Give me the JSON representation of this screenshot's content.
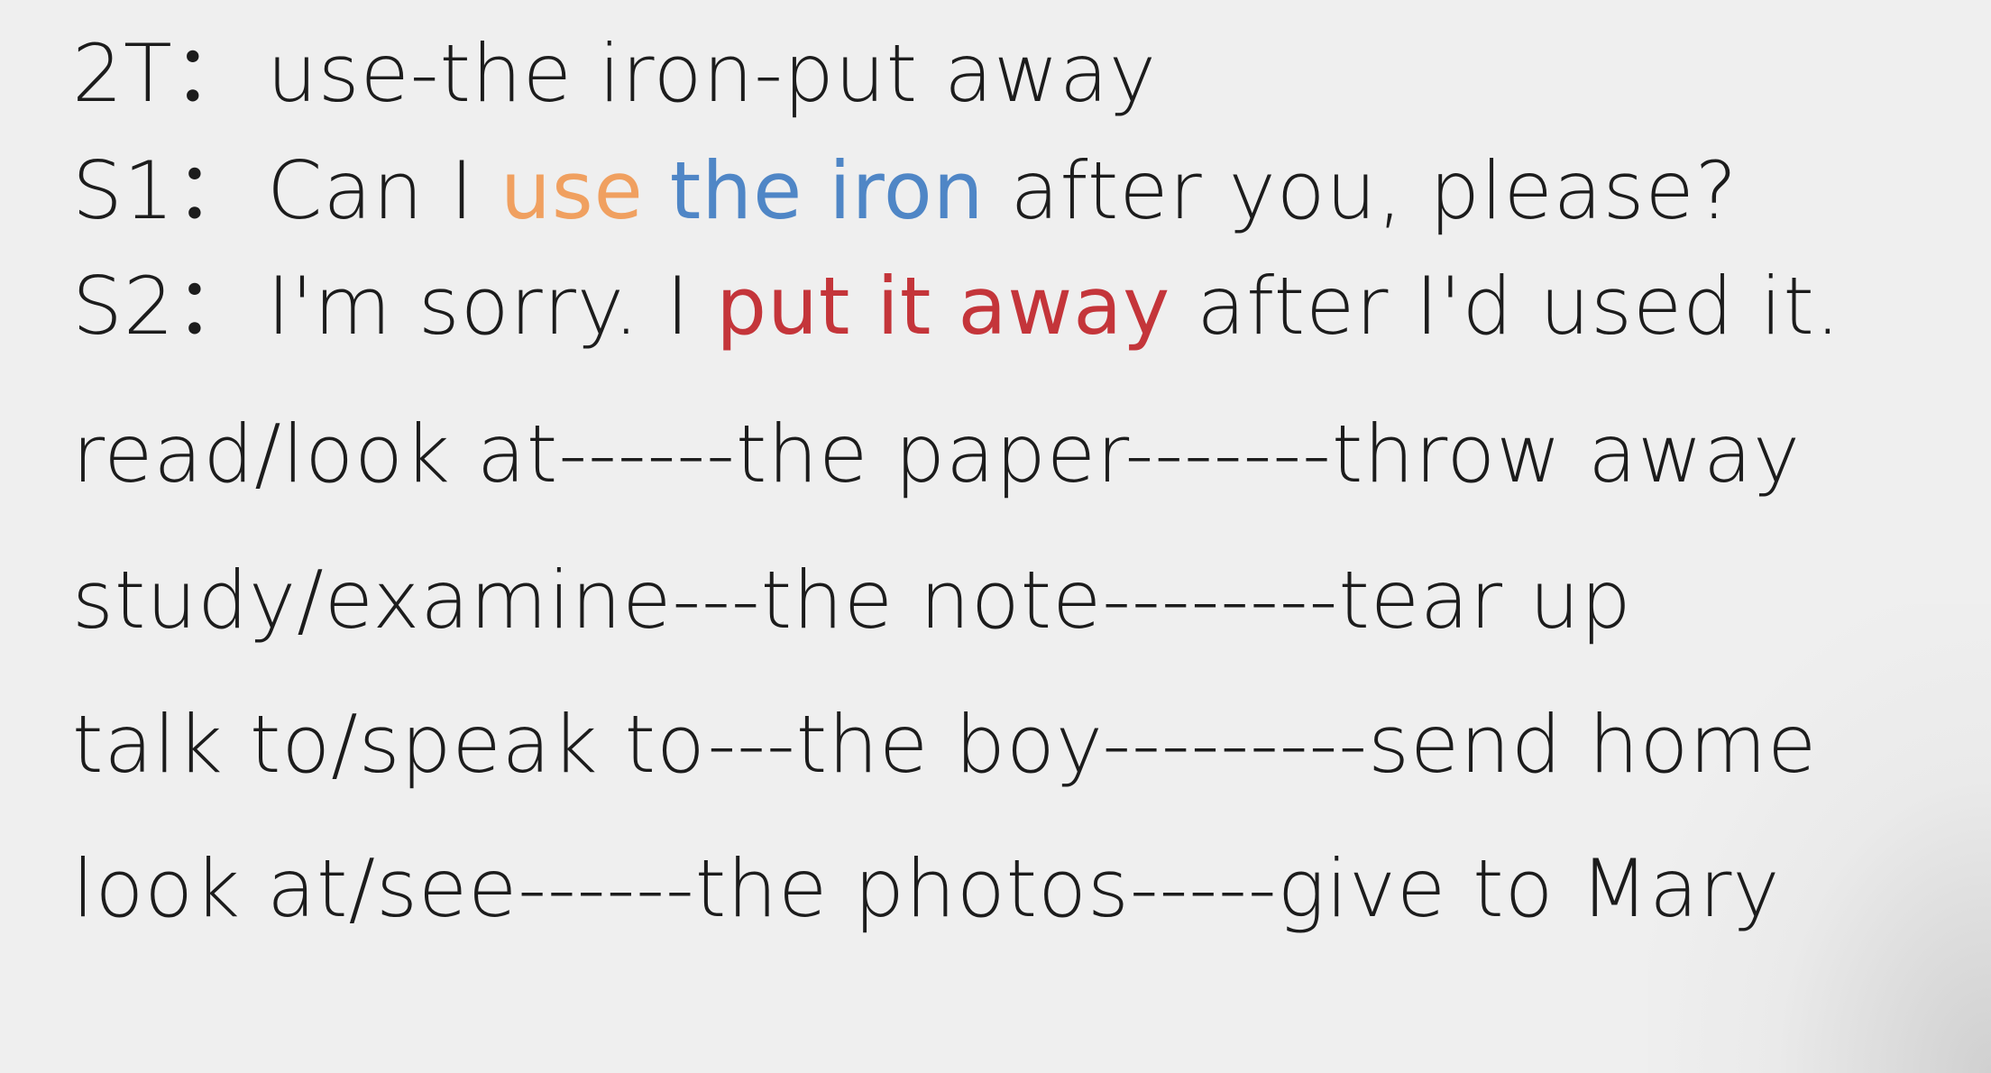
{
  "colors": {
    "background": "#efefef",
    "text": "#1c1c1c",
    "highlight_orange": "#f0a060",
    "highlight_blue": "#4f86c6",
    "highlight_red": "#c4353a"
  },
  "dialogue": [
    {
      "speaker": "2T：",
      "text": "use-the iron-put away"
    },
    {
      "speaker": "S1：",
      "before": "Can I ",
      "hl1": "use",
      "space": " ",
      "hl2": "the iron",
      "after": " after you, please?"
    },
    {
      "speaker": "S2：",
      "before": "I'm sorry. I ",
      "hl": "put it away",
      "after": " after I'd used it."
    }
  ],
  "practice_lines": [
    "read/look at------the paper-------throw away",
    "study/examine---the note--------tear up",
    "talk to/speak to---the boy---------send home",
    "look at/see------the photos-----give to Mary"
  ]
}
